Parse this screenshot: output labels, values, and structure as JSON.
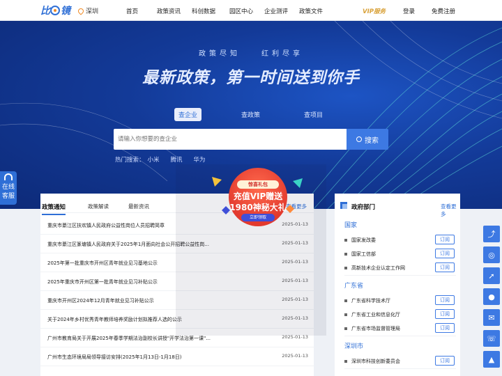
{
  "nav": {
    "city": "深圳",
    "links": [
      "首页",
      "政策资讯",
      "科创数据",
      "园区中心",
      "企业测评",
      "政策文件"
    ],
    "vip": "VIP服务",
    "login": "登录",
    "register": "免费注册"
  },
  "hero": {
    "subtitle": "政策尽知　　红利尽享",
    "title": "最新政策，第一时间送到你手",
    "tabs": [
      "查企业",
      "查政策",
      "查项目"
    ],
    "search_placeholder": "请输入你想要的查企业",
    "search_button": "搜索",
    "hot_label": "热门搜索：",
    "hot_items": [
      "小米",
      "腾讯",
      "华为"
    ]
  },
  "online": {
    "line1": "在线",
    "line2": "客服"
  },
  "popup": {
    "ribbon": "惊喜礼包",
    "line1": "充值VIP赠送",
    "line2": "1980神秘大礼",
    "button": "立即领取"
  },
  "left_panel": {
    "tabs": [
      "政策通知",
      "政策解读",
      "最新资讯"
    ],
    "more": "查看更多",
    "items": [
      {
        "title": "重庆市綦江区扶欢镇人民政府公益性岗位人员招聘简章",
        "date": "2025-01-13"
      },
      {
        "title": "重庆市綦江区篆塘镇人民政府关于2025年1月面向社会公开招聘公益性岗...",
        "date": "2025-01-13"
      },
      {
        "title": "2025年第一批重庆市开州区青年就业见习基地公示",
        "date": "2025-01-13"
      },
      {
        "title": "2025年重庆市开州区第一批青年就业见习补贴公示",
        "date": "2025-01-13"
      },
      {
        "title": "重庆市开州区2024年12月青年就业见习补贴公示",
        "date": "2025-01-13"
      },
      {
        "title": "关于2024年乡村优秀青年教师培养奖励计划拟推荐人选的公示",
        "date": "2025-01-13"
      },
      {
        "title": "广州市教育局关于开展2025年春季学期法治副校长讲授\"开学法治第一课\"...",
        "date": "2025-01-13"
      },
      {
        "title": "广州市生态环境局局领导接访安排(2025年1月13日-1月18日)",
        "date": "2025-01-13"
      }
    ]
  },
  "right_panel": {
    "title": "政府部门",
    "more": "查看更多",
    "subscribe": "订阅",
    "groups": [
      {
        "region": "国家",
        "items": [
          "国家发改委",
          "国家工信部",
          "高新技术企业认定工作网"
        ]
      },
      {
        "region": "广东省",
        "items": [
          "广东省科学技术厅",
          "广东省工业和信息化厅",
          "广东省市场监督管理局"
        ]
      },
      {
        "region": "深圳市",
        "items": [
          "深圳市科技创新委员会"
        ]
      }
    ]
  },
  "colors": {
    "primary": "#2f6fd6",
    "hero_dark": "#0d2a78",
    "accent_orange": "#f08a24",
    "popup_red": "#e23a2e"
  },
  "toolbar_icons": [
    "share-icon",
    "target-icon",
    "rocket-icon",
    "user-icon",
    "chat-icon",
    "phone-icon",
    "top-icon"
  ]
}
